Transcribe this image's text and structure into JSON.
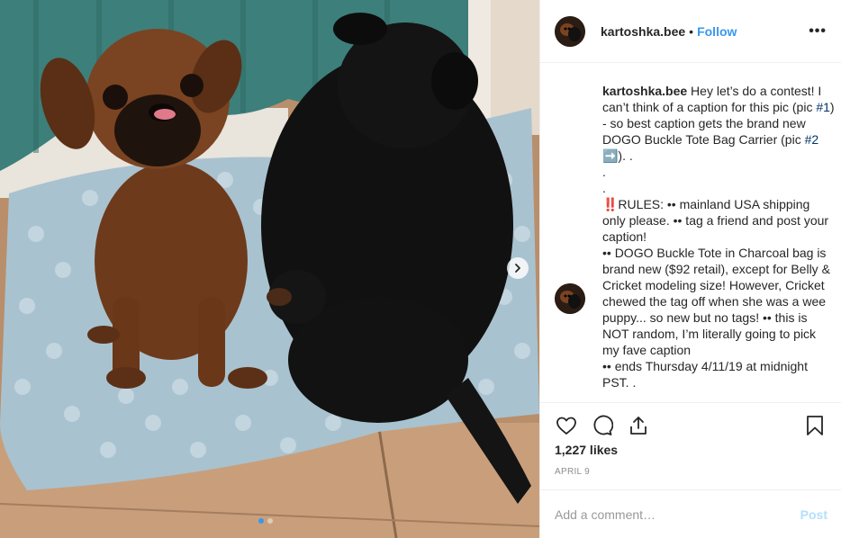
{
  "post": {
    "username": "kartoshka.bee",
    "bullet": "•",
    "follow_label": "Follow",
    "more_label": "•••",
    "caption": {
      "username": "kartoshka.bee",
      "part1": " Hey let’s do a contest! I can’t think of a caption for this pic (pic ",
      "tag1": "#1",
      "part2": ") - so best caption gets the brand new DOGO Buckle Tote Bag Carrier (pic ",
      "tag2": "#2",
      "part3": " ➡️). .\n.\n.\n‼️RULES: •• mainland USA shipping only please. •• tag a friend and post your caption!\n•• DOGO Buckle Tote in Charcoal bag is brand new ($92 retail), except for Belly & Cricket modeling size! However, Cricket chewed the tag off when she was a wee puppy... so new but no tags! •• this is NOT random, I’m literally going to pick my fave caption\n•• ends Thursday 4/11/19 at midnight PST. ."
    },
    "likes": "1,227 likes",
    "date": "APRIL 9",
    "comment": {
      "placeholder": "Add a comment…",
      "value": "",
      "post_label": "Post"
    },
    "carousel": {
      "total": 2,
      "current": 1
    }
  },
  "colors": {
    "accent": "#3897f0",
    "post_disabled": "#b2dffc",
    "meta_gray": "#8e8e8e",
    "border": "#efefef"
  },
  "icons": [
    "heart-icon",
    "comment-icon",
    "share-icon",
    "bookmark-icon",
    "chevron-right-icon",
    "more-icon"
  ]
}
